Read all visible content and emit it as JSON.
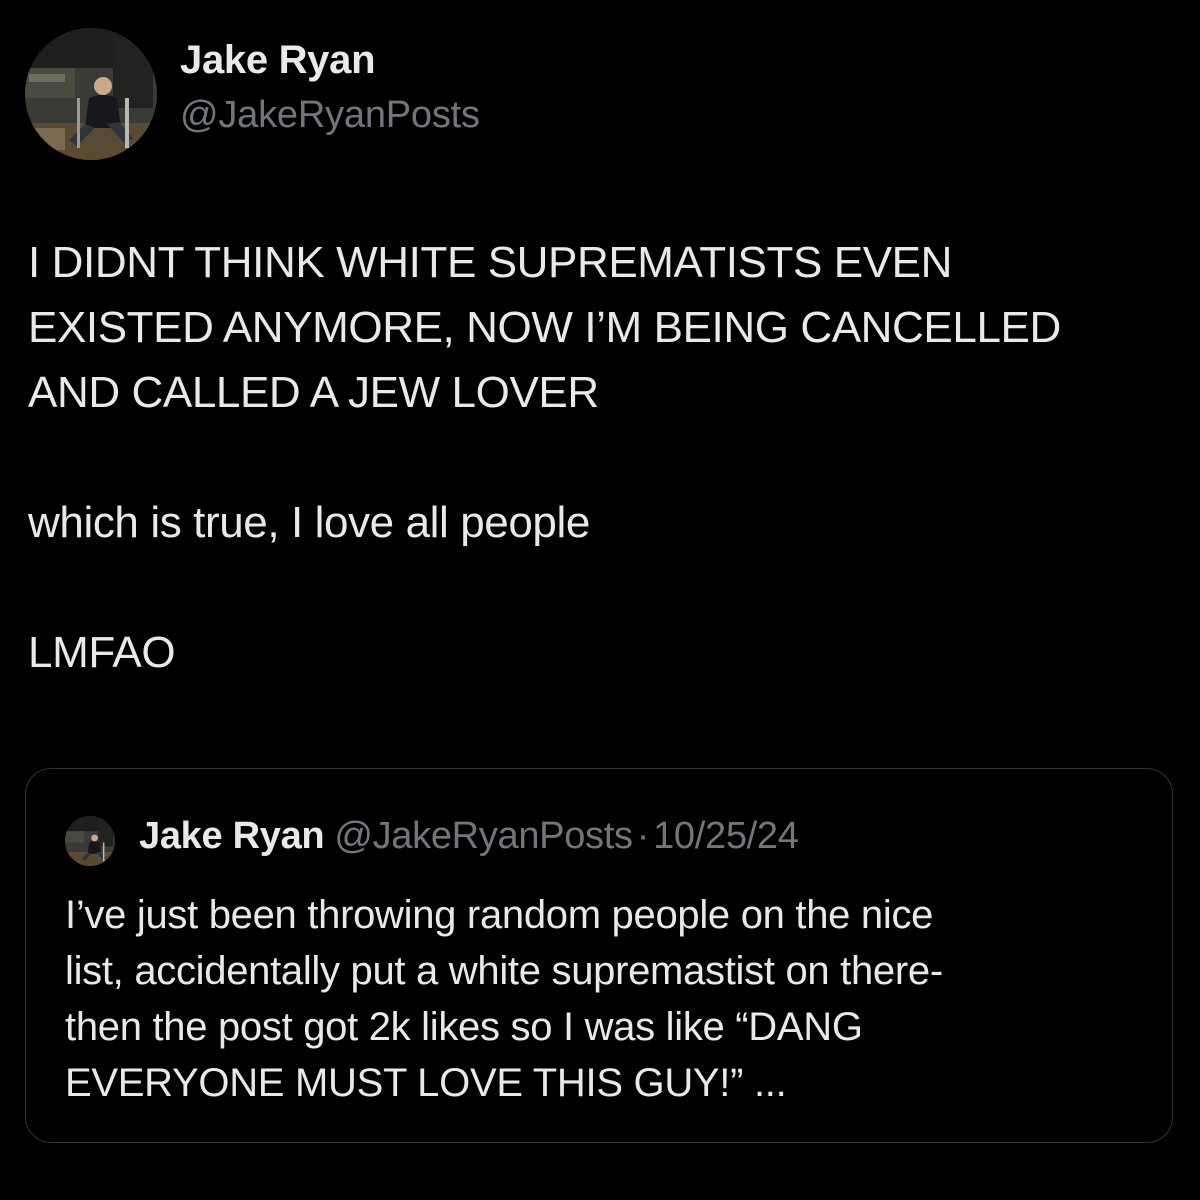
{
  "author": {
    "name": "Jake Ryan",
    "handle": "@JakeRyanPosts"
  },
  "post": {
    "lines": [
      "I DIDNT THINK WHITE SUPREMATISTS EVEN",
      "EXISTED ANYMORE, NOW I’M BEING CANCELLED",
      "AND CALLED A JEW LOVER"
    ],
    "line2": "which is true, I love all people",
    "line3": "LMFAO"
  },
  "quote": {
    "name": "Jake Ryan",
    "handle": "@JakeRyanPosts",
    "separator": "·",
    "date": "10/25/24",
    "lines": [
      "I’ve just been throwing random people on the nice",
      "list, accidentally put a white supremastist on there-",
      "then the post got 2k likes so I was like “DANG",
      "EVERYONE MUST LOVE THIS GUY!” ..."
    ]
  },
  "colors": {
    "background": "#000000",
    "text": "#e7e9ea",
    "secondary": "#71767b",
    "border": "#2f3336"
  },
  "icons": {
    "avatar": "profile-photo",
    "quote_avatar": "profile-photo"
  }
}
